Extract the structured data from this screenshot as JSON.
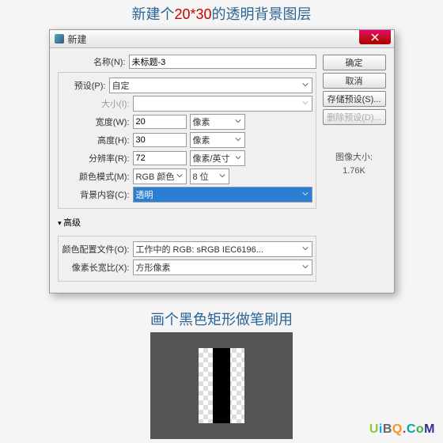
{
  "step1_title_prefix": "新建个",
  "step1_title_size": "20*30",
  "step1_title_suffix": "的透明背景图层",
  "dialog": {
    "title": "新建",
    "fields": {
      "name_label": "名称(N):",
      "name_value": "未标题-3",
      "preset_label": "预设(P):",
      "preset_value": "自定",
      "size_label": "大小(I):",
      "width_label": "宽度(W):",
      "width_value": "20",
      "width_unit": "像素",
      "height_label": "高度(H):",
      "height_value": "30",
      "height_unit": "像素",
      "resolution_label": "分辨率(R):",
      "resolution_value": "72",
      "resolution_unit": "像素/英寸",
      "colormode_label": "颜色模式(M):",
      "colormode_value": "RGB 颜色",
      "colordepth_value": "8 位",
      "bgcontent_label": "背景内容(C):",
      "bgcontent_value": "透明",
      "advanced_label": "高级",
      "colorprofile_label": "颜色配置文件(O):",
      "colorprofile_value": "工作中的 RGB: sRGB IEC6196...",
      "pixelaspect_label": "像素长宽比(X):",
      "pixelaspect_value": "方形像素"
    },
    "buttons": {
      "ok": "确定",
      "cancel": "取消",
      "save_preset": "存储预设(S)...",
      "delete_preset": "删除预设(D)..."
    },
    "filesize_label": "图像大小:",
    "filesize_value": "1.76K"
  },
  "step2_title": "画个黑色矩形做笔刷用",
  "watermark": {
    "u": "U",
    "i": "i",
    "b": "B",
    "q": "Q",
    "dot": ".",
    "c": "C",
    "o": "o",
    "m": "M"
  }
}
